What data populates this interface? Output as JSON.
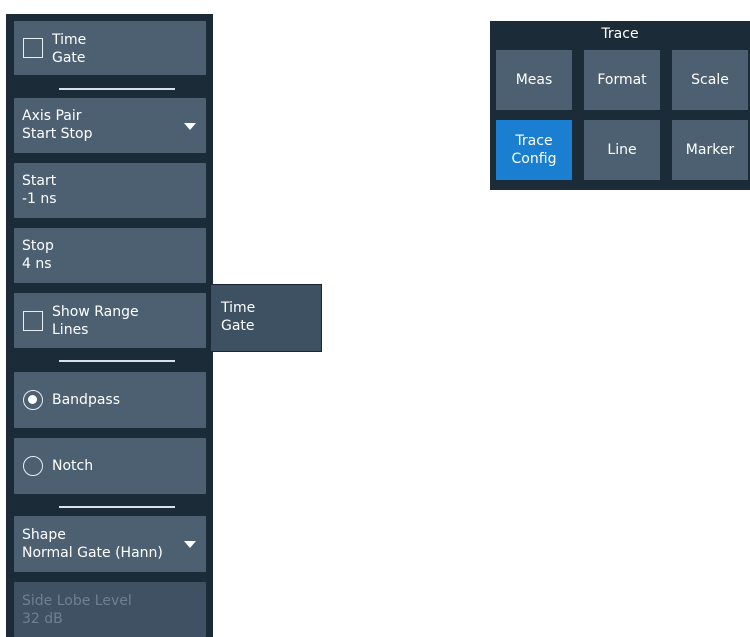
{
  "left_panel": {
    "time_gate": {
      "line1": "Time",
      "line2": "Gate",
      "checked": false
    },
    "axis_pair": {
      "label": "Axis Pair",
      "value": "Start Stop"
    },
    "start": {
      "label": "Start",
      "value": "-1 ns"
    },
    "stop": {
      "label": "Stop",
      "value": "4 ns"
    },
    "show_range_lines": {
      "line1": "Show Range",
      "line2": "Lines",
      "checked": false
    },
    "bandpass": {
      "label": "Bandpass",
      "selected": true
    },
    "notch": {
      "label": "Notch",
      "selected": false
    },
    "shape": {
      "label": "Shape",
      "value": "Normal Gate (Hann)"
    },
    "side_lobe_level": {
      "label": "Side Lobe Level",
      "value": "32 dB",
      "enabled": false
    }
  },
  "tab_flag": {
    "line1": "Time",
    "line2": "Gate"
  },
  "trace_menu": {
    "title": "Trace",
    "buttons": [
      {
        "label": "Meas"
      },
      {
        "label": "Format"
      },
      {
        "label": "Scale"
      },
      {
        "line1": "Trace",
        "line2": "Config",
        "active": true
      },
      {
        "label": "Line"
      },
      {
        "label": "Marker"
      }
    ]
  },
  "colors": {
    "panel_bg": "#1c2b38",
    "button_bg": "#4c6072",
    "active_button": "#1a7fd1",
    "disabled_text": "#6e8193"
  }
}
